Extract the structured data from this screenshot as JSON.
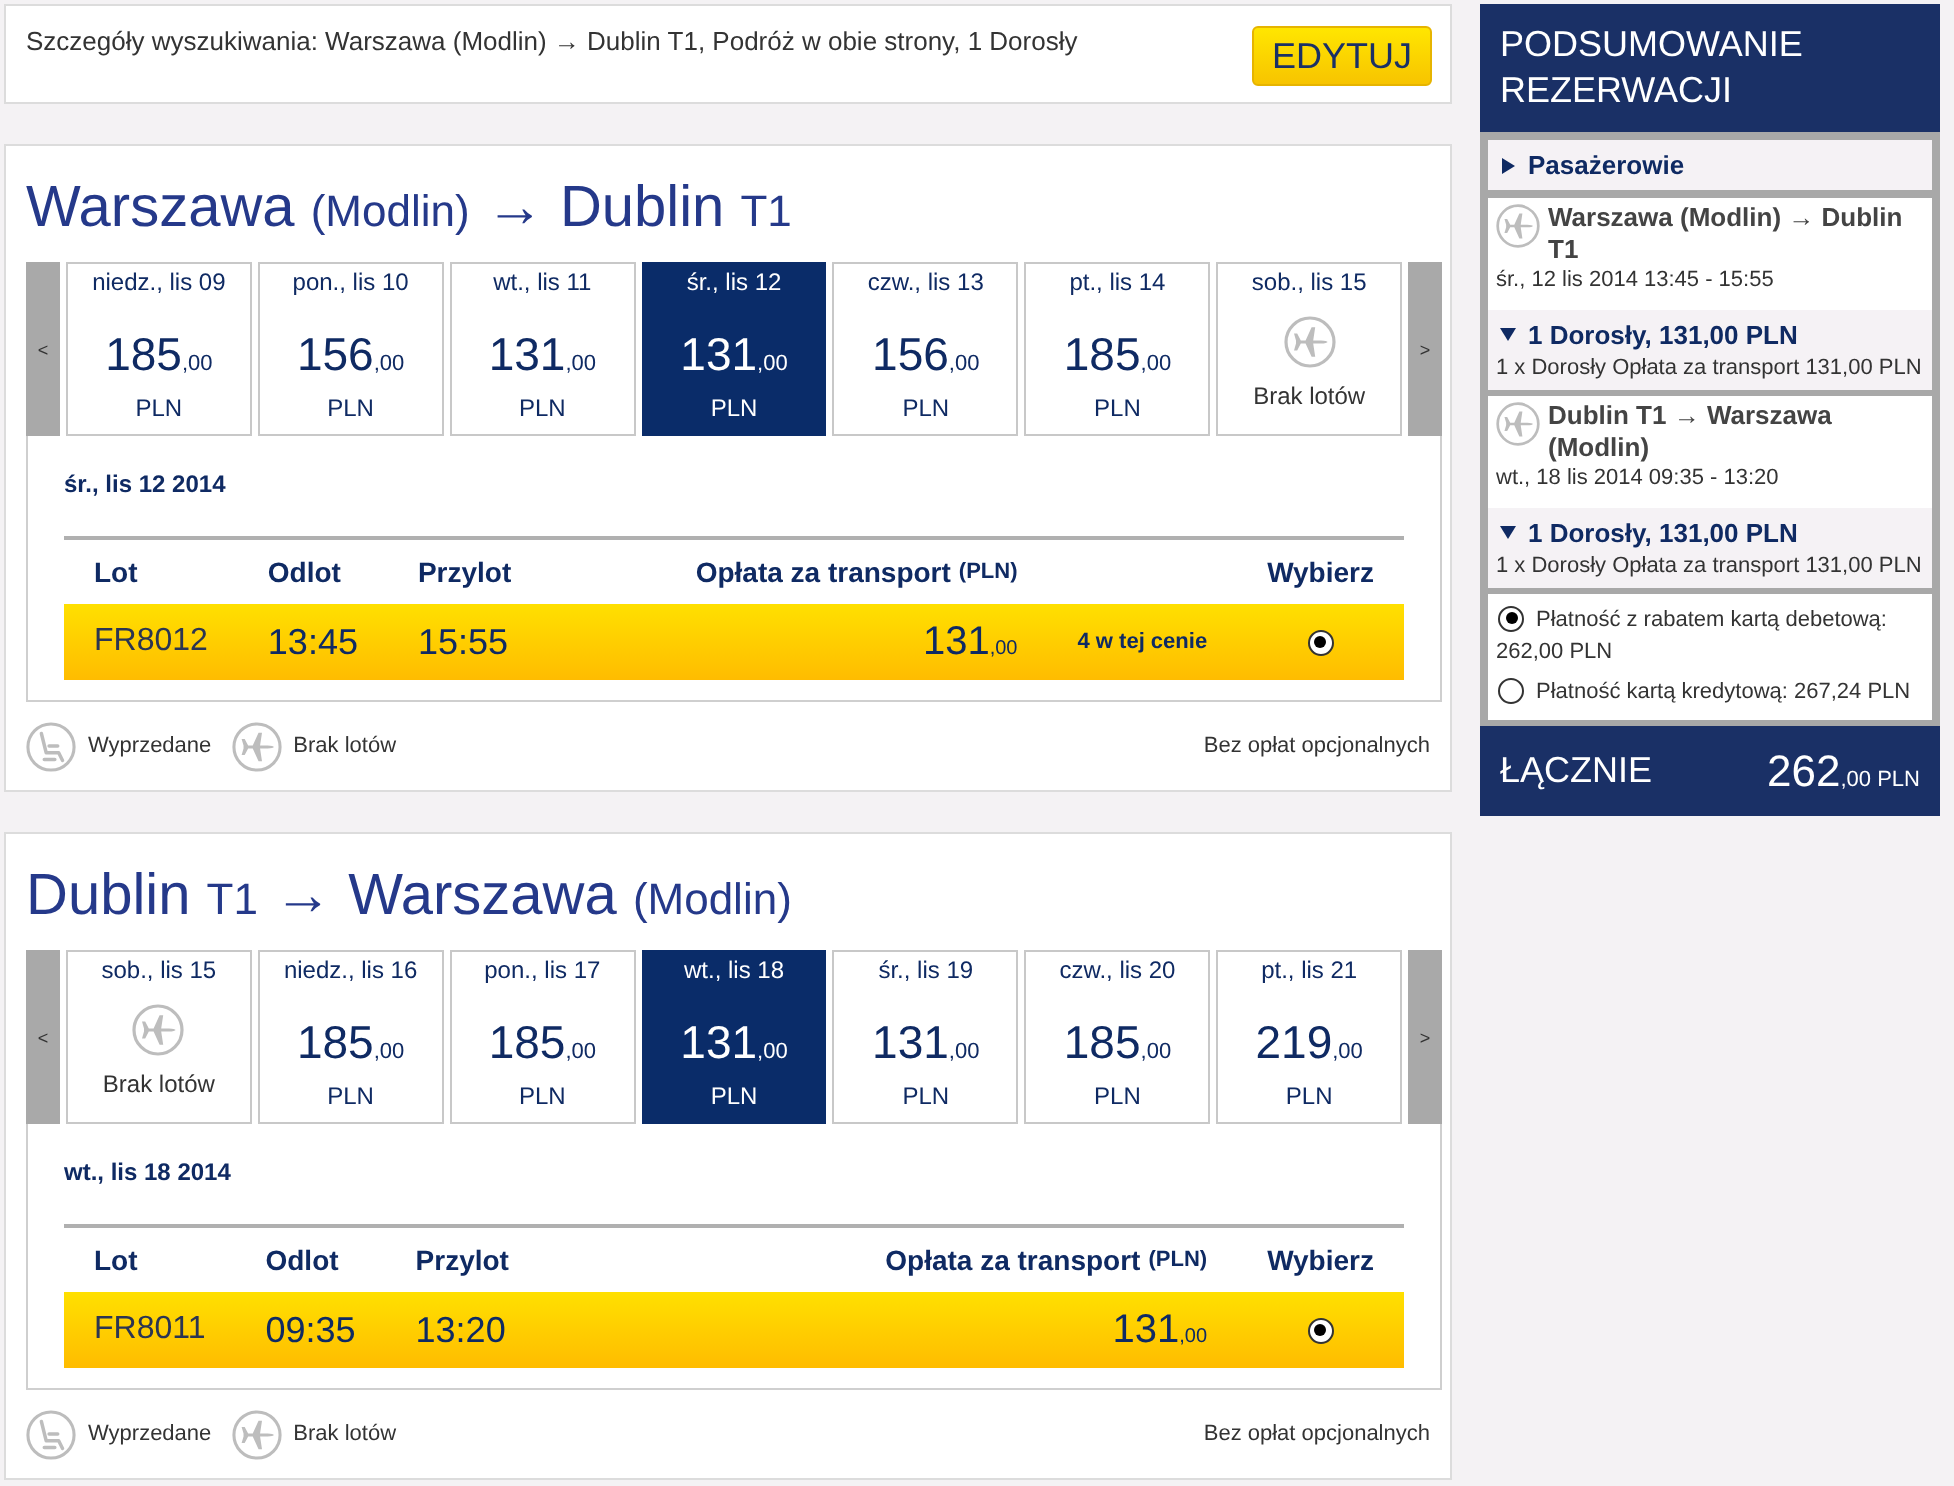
{
  "search_summary": {
    "text": "Szczegóły wyszukiwania: Warszawa (Modlin) → Dublin T1, Podróż w obie strony, 1 Dorosły",
    "edit_button": "EDYTUJ"
  },
  "journeys": [
    {
      "title": {
        "origin": "Warszawa",
        "origin_airport": "(Modlin)",
        "arrow": "→",
        "destination": "Dublin",
        "destination_airport": "T1"
      },
      "prev_button": "<",
      "next_button": ">",
      "dates": [
        {
          "kind": "fare",
          "day": "niedz., lis 09",
          "price": "185",
          "decimals": ",00",
          "currency": "PLN",
          "selected": false
        },
        {
          "kind": "fare",
          "day": "pon., lis 10",
          "price": "156",
          "decimals": ",00",
          "currency": "PLN",
          "selected": false
        },
        {
          "kind": "fare",
          "day": "wt., lis 11",
          "price": "131",
          "decimals": ",00",
          "currency": "PLN",
          "selected": false
        },
        {
          "kind": "fare",
          "day": "śr., lis 12",
          "price": "131",
          "decimals": ",00",
          "currency": "PLN",
          "selected": true
        },
        {
          "kind": "fare",
          "day": "czw., lis 13",
          "price": "156",
          "decimals": ",00",
          "currency": "PLN",
          "selected": false
        },
        {
          "kind": "fare",
          "day": "pt., lis 14",
          "price": "185",
          "decimals": ",00",
          "currency": "PLN",
          "selected": false
        },
        {
          "kind": "no_flights",
          "day": "sob., lis 15",
          "note": "Brak lotów",
          "selected": false
        }
      ],
      "selected_date": "śr., lis 12 2014",
      "columns": {
        "flight": "Lot",
        "departure": "Odlot",
        "arrival": "Przylot",
        "fare": "Opłata za transport",
        "fare_currency": "(PLN)",
        "select": "Wybierz"
      },
      "flights": [
        {
          "number": "FR8012",
          "departure": "13:45",
          "arrival": "15:55",
          "price": "131",
          "decimals": ",00",
          "availability": "4 w tej cenie",
          "selected": true
        }
      ],
      "legend": [
        {
          "kind": "sold_out",
          "label": "Wyprzedane"
        },
        {
          "kind": "no_flights",
          "label": "Brak lotów"
        }
      ],
      "fees_note": "Bez opłat opcjonalnych"
    },
    {
      "title": {
        "origin": "Dublin",
        "origin_airport": "T1",
        "arrow": "→",
        "destination": "Warszawa",
        "destination_airport": "(Modlin)"
      },
      "prev_button": "<",
      "next_button": ">",
      "dates": [
        {
          "kind": "no_flights",
          "day": "sob., lis 15",
          "note": "Brak lotów",
          "selected": false
        },
        {
          "kind": "fare",
          "day": "niedz., lis 16",
          "price": "185",
          "decimals": ",00",
          "currency": "PLN",
          "selected": false
        },
        {
          "kind": "fare",
          "day": "pon., lis 17",
          "price": "185",
          "decimals": ",00",
          "currency": "PLN",
          "selected": false
        },
        {
          "kind": "fare",
          "day": "wt., lis 18",
          "price": "131",
          "decimals": ",00",
          "currency": "PLN",
          "selected": true
        },
        {
          "kind": "fare",
          "day": "śr., lis 19",
          "price": "131",
          "decimals": ",00",
          "currency": "PLN",
          "selected": false
        },
        {
          "kind": "fare",
          "day": "czw., lis 20",
          "price": "185",
          "decimals": ",00",
          "currency": "PLN",
          "selected": false
        },
        {
          "kind": "fare",
          "day": "pt., lis 21",
          "price": "219",
          "decimals": ",00",
          "currency": "PLN",
          "selected": false
        }
      ],
      "selected_date": "wt., lis 18 2014",
      "columns": {
        "flight": "Lot",
        "departure": "Odlot",
        "arrival": "Przylot",
        "fare": "Opłata za transport",
        "fare_currency": "(PLN)",
        "select": "Wybierz"
      },
      "flights": [
        {
          "number": "FR8011",
          "departure": "09:35",
          "arrival": "13:20",
          "price": "131",
          "decimals": ",00",
          "selected": true
        }
      ],
      "legend": [
        {
          "kind": "sold_out",
          "label": "Wyprzedane"
        },
        {
          "kind": "no_flights",
          "label": "Brak lotów"
        }
      ],
      "fees_note": "Bez opłat opcjonalnych"
    }
  ],
  "summary": {
    "title": "PODSUMOWANIE REZERWACJI",
    "passengers": {
      "label": "Pasażerowie",
      "expanded": false
    },
    "legs": [
      {
        "route": "Warszawa (Modlin) → Dublin T1",
        "datetime": "śr., 12 lis 2014 13:45 - 15:55",
        "fare_group": {
          "label": "1 Dorosły, 131,00 PLN",
          "expanded": true
        },
        "fare_line": {
          "label": "1 x Dorosły Opłata za transport",
          "amount": "131,00 PLN"
        }
      },
      {
        "route": "Dublin T1 → Warszawa (Modlin)",
        "datetime": "wt., 18 lis 2014 09:35 - 13:20",
        "fare_group": {
          "label": "1 Dorosły, 131,00 PLN",
          "expanded": true
        },
        "fare_line": {
          "label": "1 x Dorosły Opłata za transport",
          "amount": "131,00 PLN"
        }
      }
    ],
    "payment_options": [
      {
        "label": "Płatność z rabatem kartą debetową: 262,00 PLN",
        "selected": true
      },
      {
        "label": "Płatność kartą kredytową: 267,24 PLN",
        "selected": false
      }
    ],
    "total": {
      "label": "ŁĄCZNIE",
      "amount": "262",
      "decimals": ",00",
      "currency": "PLN"
    }
  }
}
